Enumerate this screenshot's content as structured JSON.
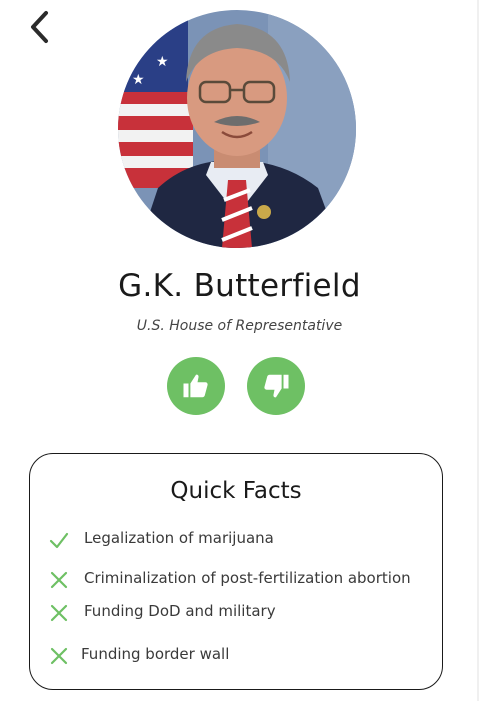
{
  "profile": {
    "name": "G.K. Butterfield",
    "title": "U.S. House of Representative"
  },
  "icons": {
    "back": "chevron-left-icon",
    "like": "thumbs-up-icon",
    "dislike": "thumbs-down-icon",
    "supported": "check-icon",
    "opposed": "x-icon"
  },
  "colors": {
    "accent_green": "#6ec064",
    "text_dark": "#1a1a1a"
  },
  "quick_facts": {
    "title": "Quick Facts",
    "items": [
      {
        "label": "Legalization of marijuana",
        "status": "supported"
      },
      {
        "label": "Criminalization of post-fertilization abortion",
        "status": "opposed"
      },
      {
        "label": "Funding DoD and military",
        "status": "opposed"
      },
      {
        "label": "Funding border wall",
        "status": "opposed"
      }
    ]
  }
}
